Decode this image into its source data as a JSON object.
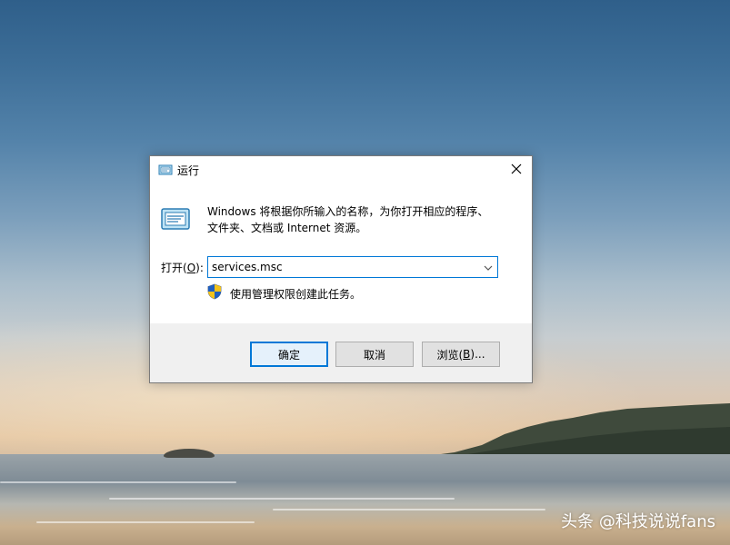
{
  "dialog": {
    "title": "运行",
    "description_line1": "Windows 将根据你所输入的名称，为你打开相应的程序、",
    "description_line2": "文件夹、文档或 Internet 资源。",
    "open_label_prefix": "打开(",
    "open_label_key": "O",
    "open_label_suffix": "):",
    "input_value": "services.msc",
    "admin_note": "使用管理权限创建此任务。",
    "buttons": {
      "ok": "确定",
      "cancel": "取消",
      "browse_prefix": "浏览(",
      "browse_key": "B",
      "browse_suffix": ")..."
    }
  },
  "watermark": "头条 @科技说说fans",
  "colors": {
    "accent": "#0078d7",
    "footer_bg": "#f0f0f0",
    "button_bg": "#e1e1e1"
  },
  "icons": [
    "run-icon",
    "close-icon",
    "run-large-icon",
    "chevron-down-icon",
    "uac-shield-icon"
  ]
}
